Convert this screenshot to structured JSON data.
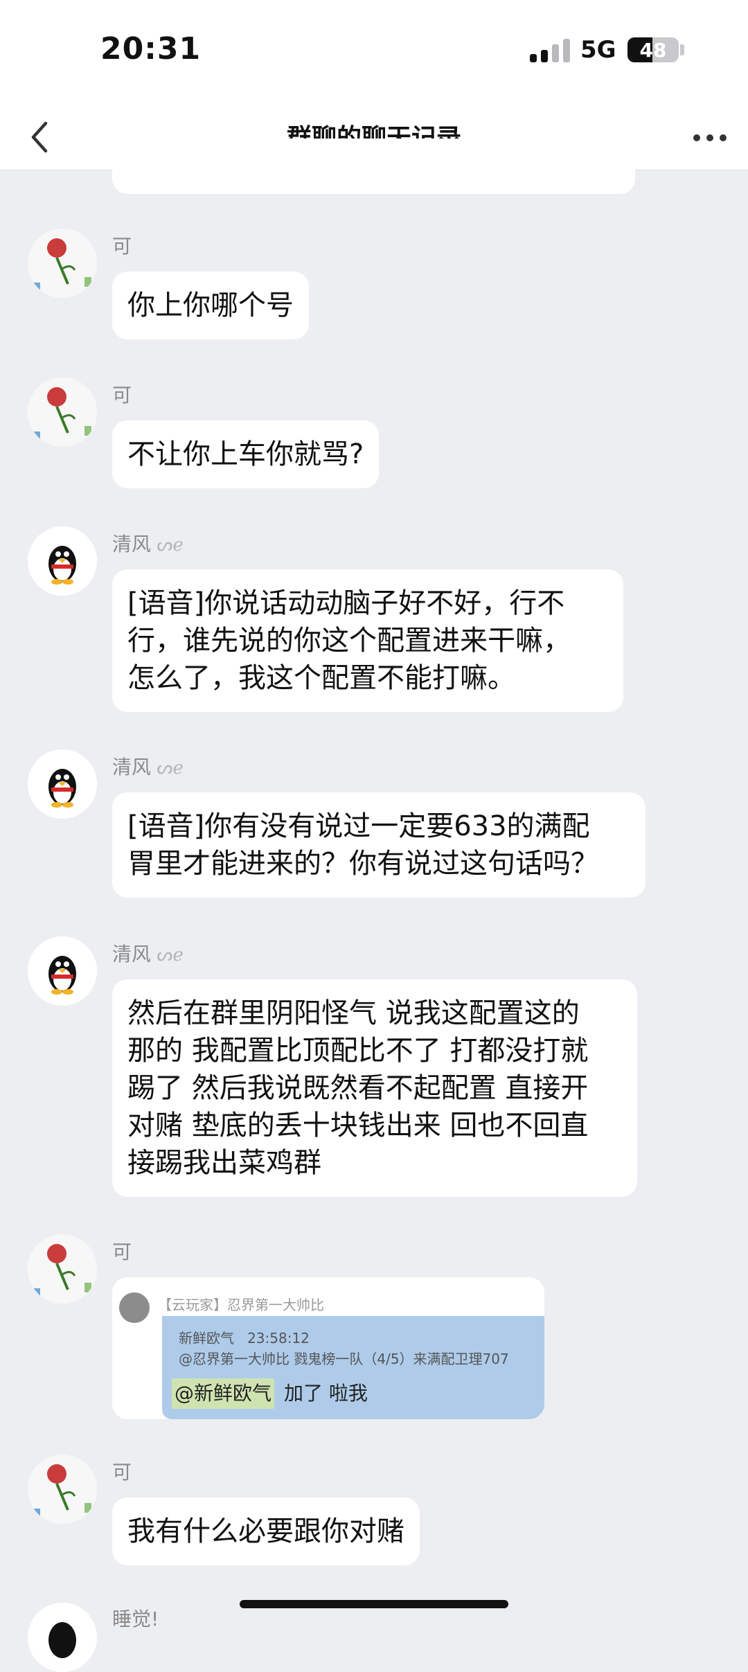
{
  "status_bar": {
    "time": "20:31",
    "network": "5G",
    "battery": "48",
    "battery_level": 0.48
  },
  "nav": {
    "title": "群聊的聊天记录",
    "back_icon": "chevron-left-icon",
    "more_icon": "more-dots-icon"
  },
  "messages": [
    {
      "sender": "可",
      "avatar": "rose-sticker-avatar",
      "text": "你上你哪个号"
    },
    {
      "sender": "可",
      "avatar": "rose-sticker-avatar",
      "text": "不让你上车你就骂?"
    },
    {
      "sender": "清风",
      "avatar": "qq-penguin-avatar",
      "text_lines": [
        "[语音]你说话动动脑子好不好，行不",
        "行，谁先说的你这个配置进来干嘛，",
        "怎么了，我这个配置不能打嘛。"
      ]
    },
    {
      "sender": "清风",
      "avatar": "qq-penguin-avatar",
      "text_lines": [
        "[语音]你有没有说过一定要633的满配",
        "胃里才能进来的？你有说过这句话吗？"
      ]
    },
    {
      "sender": "清风",
      "avatar": "qq-penguin-avatar",
      "text_lines": [
        "然后在群里阴阳怪气 说我这配置这的",
        "那的 我配置比顶配比不了 打都没打就",
        "踢了 然后我说既然看不起配置 直接开",
        "对赌 垫底的丢十块钱出来 回也不回直",
        "接踢我出菜鸡群"
      ]
    },
    {
      "sender": "可",
      "avatar": "rose-sticker-avatar",
      "image": {
        "header": "【云玩家】忍界第一大帅比",
        "quote_sender": "新鲜欧气",
        "quote_time": "23:58:12",
        "quote_text": "@忍界第一大帅比 戮鬼榜一队（4/5）来满配卫理707",
        "mention": "@新鲜欧气",
        "reply": "加了 啦我"
      }
    },
    {
      "sender": "可",
      "avatar": "rose-sticker-avatar",
      "text": "我有什么必要跟你对赌"
    },
    {
      "sender": "睡觉!",
      "avatar": "qq-penguin-avatar"
    }
  ]
}
